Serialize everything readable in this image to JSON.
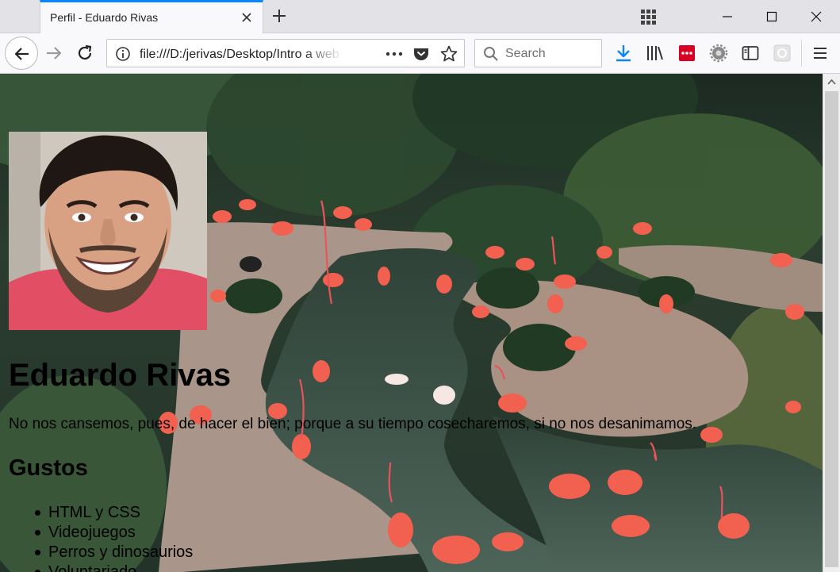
{
  "browser": {
    "tab_title": "Perfil - Eduardo Rivas",
    "url": "file:///D:/jerivas/Desktop/Intro a web",
    "search_placeholder": "Search"
  },
  "profile": {
    "name": "Eduardo Rivas",
    "quote": "No nos cansemos, pues, de hacer el bien; porque a su tiempo cosecharemos, si no nos desanimamos.",
    "likes_heading": "Gustos",
    "likes": [
      "HTML y CSS",
      "Videojuegos",
      "Perros y dinosaurios",
      "Voluntariado"
    ]
  },
  "icons": {
    "tab_close": "close-icon",
    "new_tab": "plus-icon",
    "tab_overflow": "grid-icon",
    "back": "arrow-left-icon",
    "forward": "arrow-right-icon",
    "reload": "reload-icon",
    "site_info": "info-icon",
    "page_actions": "more-horizontal-icon",
    "pocket": "pocket-icon",
    "bookmark": "star-icon",
    "search": "search-icon",
    "downloads": "download-icon",
    "library": "library-icon",
    "sidebar": "sidebar-icon",
    "menu": "hamburger-icon"
  },
  "colors": {
    "tab_accent": "#0a84ff",
    "download_accent": "#0a84ff",
    "extension_red": "#d70022",
    "background_water": "#3f5648",
    "flamingo": "#f2604f"
  }
}
